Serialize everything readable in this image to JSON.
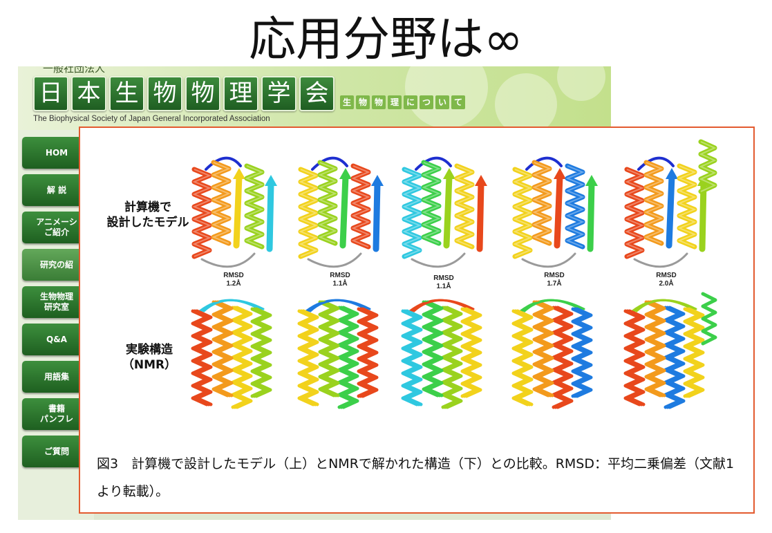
{
  "slide": {
    "title": "応用分野は∞"
  },
  "website": {
    "org_type": "一般社団法人",
    "logo_chars": [
      "日",
      "本",
      "生",
      "物",
      "物",
      "理",
      "学",
      "会"
    ],
    "english_name": "The Biophysical Society of Japan General Incorporated Association",
    "about_chars": [
      "生",
      "物",
      "物",
      "理",
      "に",
      "つ",
      "い",
      "て"
    ],
    "nav": [
      {
        "label": "HOM",
        "style": "dark"
      },
      {
        "label": "解 説",
        "style": "dark"
      },
      {
        "label": "アニメーシ\nご紹介",
        "style": "dark"
      },
      {
        "label": "研究の紹",
        "style": "light"
      },
      {
        "label": "生物物理\n研究室",
        "style": "dark"
      },
      {
        "label": "Q&A",
        "style": "dark"
      },
      {
        "label": "用語集",
        "style": "dark"
      },
      {
        "label": "書籍\nパンフレ",
        "style": "dark"
      },
      {
        "label": "ご質問",
        "style": "dark"
      }
    ]
  },
  "figure": {
    "row_labels": {
      "model": "計算機で\n設計したモデル",
      "nmr": "実験構造\n（NMR）"
    },
    "rmsd": [
      "RMSD\n1.2Å",
      "RMSD\n1.1Å",
      "RMSD\n1.1Å",
      "RMSD\n1.7Å",
      "RMSD\n2.0Å"
    ],
    "caption": "図3　計算機で設計したモデル（上）とNMRで解かれた構造（下）との比較。RMSD：平均二乗偏差（文献1より転載）。",
    "colors": [
      "#1e2fd0",
      "#1e7be0",
      "#2fc8e0",
      "#3ccf4a",
      "#9ad21e",
      "#f2d21c",
      "#f39a1c",
      "#e8481c",
      "#d41c1c",
      "#9a9a9a"
    ]
  }
}
